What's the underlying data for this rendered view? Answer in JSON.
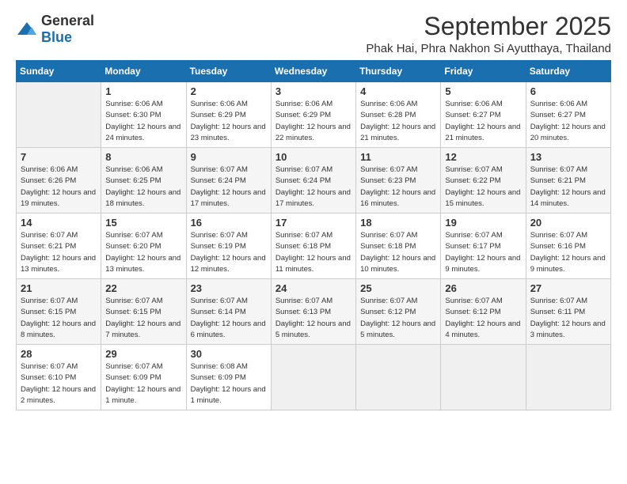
{
  "logo": {
    "general": "General",
    "blue": "Blue"
  },
  "title": {
    "month": "September 2025",
    "location": "Phak Hai, Phra Nakhon Si Ayutthaya, Thailand"
  },
  "weekdays": [
    "Sunday",
    "Monday",
    "Tuesday",
    "Wednesday",
    "Thursday",
    "Friday",
    "Saturday"
  ],
  "weeks": [
    [
      null,
      {
        "day": "1",
        "sunrise": "6:06 AM",
        "sunset": "6:30 PM",
        "daylight": "12 hours and 24 minutes."
      },
      {
        "day": "2",
        "sunrise": "6:06 AM",
        "sunset": "6:29 PM",
        "daylight": "12 hours and 23 minutes."
      },
      {
        "day": "3",
        "sunrise": "6:06 AM",
        "sunset": "6:29 PM",
        "daylight": "12 hours and 22 minutes."
      },
      {
        "day": "4",
        "sunrise": "6:06 AM",
        "sunset": "6:28 PM",
        "daylight": "12 hours and 21 minutes."
      },
      {
        "day": "5",
        "sunrise": "6:06 AM",
        "sunset": "6:27 PM",
        "daylight": "12 hours and 21 minutes."
      },
      {
        "day": "6",
        "sunrise": "6:06 AM",
        "sunset": "6:27 PM",
        "daylight": "12 hours and 20 minutes."
      }
    ],
    [
      {
        "day": "7",
        "sunrise": "6:06 AM",
        "sunset": "6:26 PM",
        "daylight": "12 hours and 19 minutes."
      },
      {
        "day": "8",
        "sunrise": "6:06 AM",
        "sunset": "6:25 PM",
        "daylight": "12 hours and 18 minutes."
      },
      {
        "day": "9",
        "sunrise": "6:07 AM",
        "sunset": "6:24 PM",
        "daylight": "12 hours and 17 minutes."
      },
      {
        "day": "10",
        "sunrise": "6:07 AM",
        "sunset": "6:24 PM",
        "daylight": "12 hours and 17 minutes."
      },
      {
        "day": "11",
        "sunrise": "6:07 AM",
        "sunset": "6:23 PM",
        "daylight": "12 hours and 16 minutes."
      },
      {
        "day": "12",
        "sunrise": "6:07 AM",
        "sunset": "6:22 PM",
        "daylight": "12 hours and 15 minutes."
      },
      {
        "day": "13",
        "sunrise": "6:07 AM",
        "sunset": "6:21 PM",
        "daylight": "12 hours and 14 minutes."
      }
    ],
    [
      {
        "day": "14",
        "sunrise": "6:07 AM",
        "sunset": "6:21 PM",
        "daylight": "12 hours and 13 minutes."
      },
      {
        "day": "15",
        "sunrise": "6:07 AM",
        "sunset": "6:20 PM",
        "daylight": "12 hours and 13 minutes."
      },
      {
        "day": "16",
        "sunrise": "6:07 AM",
        "sunset": "6:19 PM",
        "daylight": "12 hours and 12 minutes."
      },
      {
        "day": "17",
        "sunrise": "6:07 AM",
        "sunset": "6:18 PM",
        "daylight": "12 hours and 11 minutes."
      },
      {
        "day": "18",
        "sunrise": "6:07 AM",
        "sunset": "6:18 PM",
        "daylight": "12 hours and 10 minutes."
      },
      {
        "day": "19",
        "sunrise": "6:07 AM",
        "sunset": "6:17 PM",
        "daylight": "12 hours and 9 minutes."
      },
      {
        "day": "20",
        "sunrise": "6:07 AM",
        "sunset": "6:16 PM",
        "daylight": "12 hours and 9 minutes."
      }
    ],
    [
      {
        "day": "21",
        "sunrise": "6:07 AM",
        "sunset": "6:15 PM",
        "daylight": "12 hours and 8 minutes."
      },
      {
        "day": "22",
        "sunrise": "6:07 AM",
        "sunset": "6:15 PM",
        "daylight": "12 hours and 7 minutes."
      },
      {
        "day": "23",
        "sunrise": "6:07 AM",
        "sunset": "6:14 PM",
        "daylight": "12 hours and 6 minutes."
      },
      {
        "day": "24",
        "sunrise": "6:07 AM",
        "sunset": "6:13 PM",
        "daylight": "12 hours and 5 minutes."
      },
      {
        "day": "25",
        "sunrise": "6:07 AM",
        "sunset": "6:12 PM",
        "daylight": "12 hours and 5 minutes."
      },
      {
        "day": "26",
        "sunrise": "6:07 AM",
        "sunset": "6:12 PM",
        "daylight": "12 hours and 4 minutes."
      },
      {
        "day": "27",
        "sunrise": "6:07 AM",
        "sunset": "6:11 PM",
        "daylight": "12 hours and 3 minutes."
      }
    ],
    [
      {
        "day": "28",
        "sunrise": "6:07 AM",
        "sunset": "6:10 PM",
        "daylight": "12 hours and 2 minutes."
      },
      {
        "day": "29",
        "sunrise": "6:07 AM",
        "sunset": "6:09 PM",
        "daylight": "12 hours and 1 minute."
      },
      {
        "day": "30",
        "sunrise": "6:08 AM",
        "sunset": "6:09 PM",
        "daylight": "12 hours and 1 minute."
      },
      null,
      null,
      null,
      null
    ]
  ]
}
